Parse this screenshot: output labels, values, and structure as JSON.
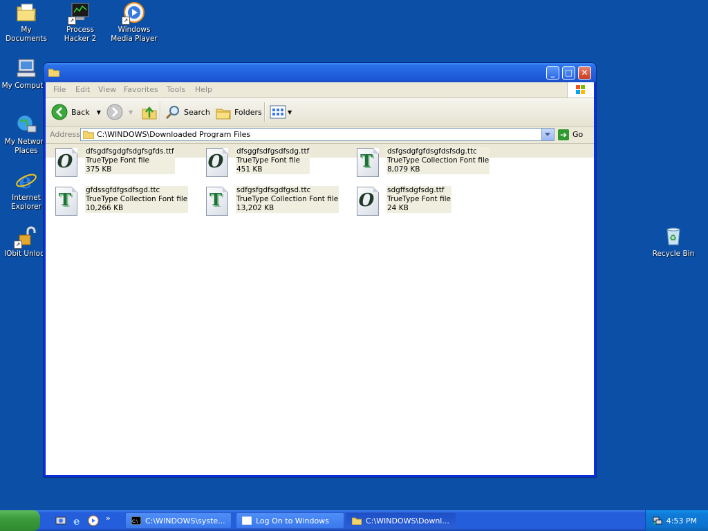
{
  "desktop": {
    "icons": [
      {
        "label": "My Documents"
      },
      {
        "label": "Process Hacker 2"
      },
      {
        "label": "Windows Media Player"
      },
      {
        "label": "My Computer"
      },
      {
        "label": "My Network Places"
      },
      {
        "label": "Internet Explorer"
      },
      {
        "label": "IObit Unlock"
      },
      {
        "label": "Recycle Bin"
      }
    ]
  },
  "window": {
    "menu": [
      "File",
      "Edit",
      "View",
      "Favorites",
      "Tools",
      "Help"
    ],
    "toolbar": {
      "back": "Back",
      "search": "Search",
      "folders": "Folders"
    },
    "address": {
      "label": "Address",
      "path": "C:\\WINDOWS\\Downloaded Program Files",
      "go": "Go"
    },
    "files": [
      {
        "name": "dfsgdfsgdgfsdgfsgfds.ttf",
        "type": "TrueType Font file",
        "size": "375 KB",
        "icon": "truetype-font-icon"
      },
      {
        "name": "dfsggfsdfgsdfsdg.ttf",
        "type": "TrueType Font file",
        "size": "451 KB",
        "icon": "truetype-font-icon"
      },
      {
        "name": "dsfgsdgfgfdsgfdsfsdg.ttc",
        "type": "TrueType Collection Font file",
        "size": "8,079 KB",
        "icon": "truetype-collection-icon"
      },
      {
        "name": "gfdssgfdfgsdfsgd.ttc",
        "type": "TrueType Collection Font file",
        "size": "10,266 KB",
        "icon": "truetype-collection-icon"
      },
      {
        "name": "sdfgsfgdfsgdfgsd.ttc",
        "type": "TrueType Collection Font file",
        "size": "13,202 KB",
        "icon": "truetype-collection-icon"
      },
      {
        "name": "sdgffsdgfsdg.ttf",
        "type": "TrueType Font file",
        "size": "24 KB",
        "icon": "truetype-font-icon"
      }
    ]
  },
  "taskbar": {
    "tasks": [
      {
        "label": "C:\\WINDOWS\\syste..."
      },
      {
        "label": "Log On to Windows"
      },
      {
        "label": "C:\\WINDOWS\\Downl..."
      }
    ],
    "quicklaunch_more": "»",
    "clock": "4:53 PM"
  },
  "colors": {
    "desktop": "#0c4fa6",
    "titlebar": "#2262e0",
    "selection_bg": "#f0eedf"
  }
}
